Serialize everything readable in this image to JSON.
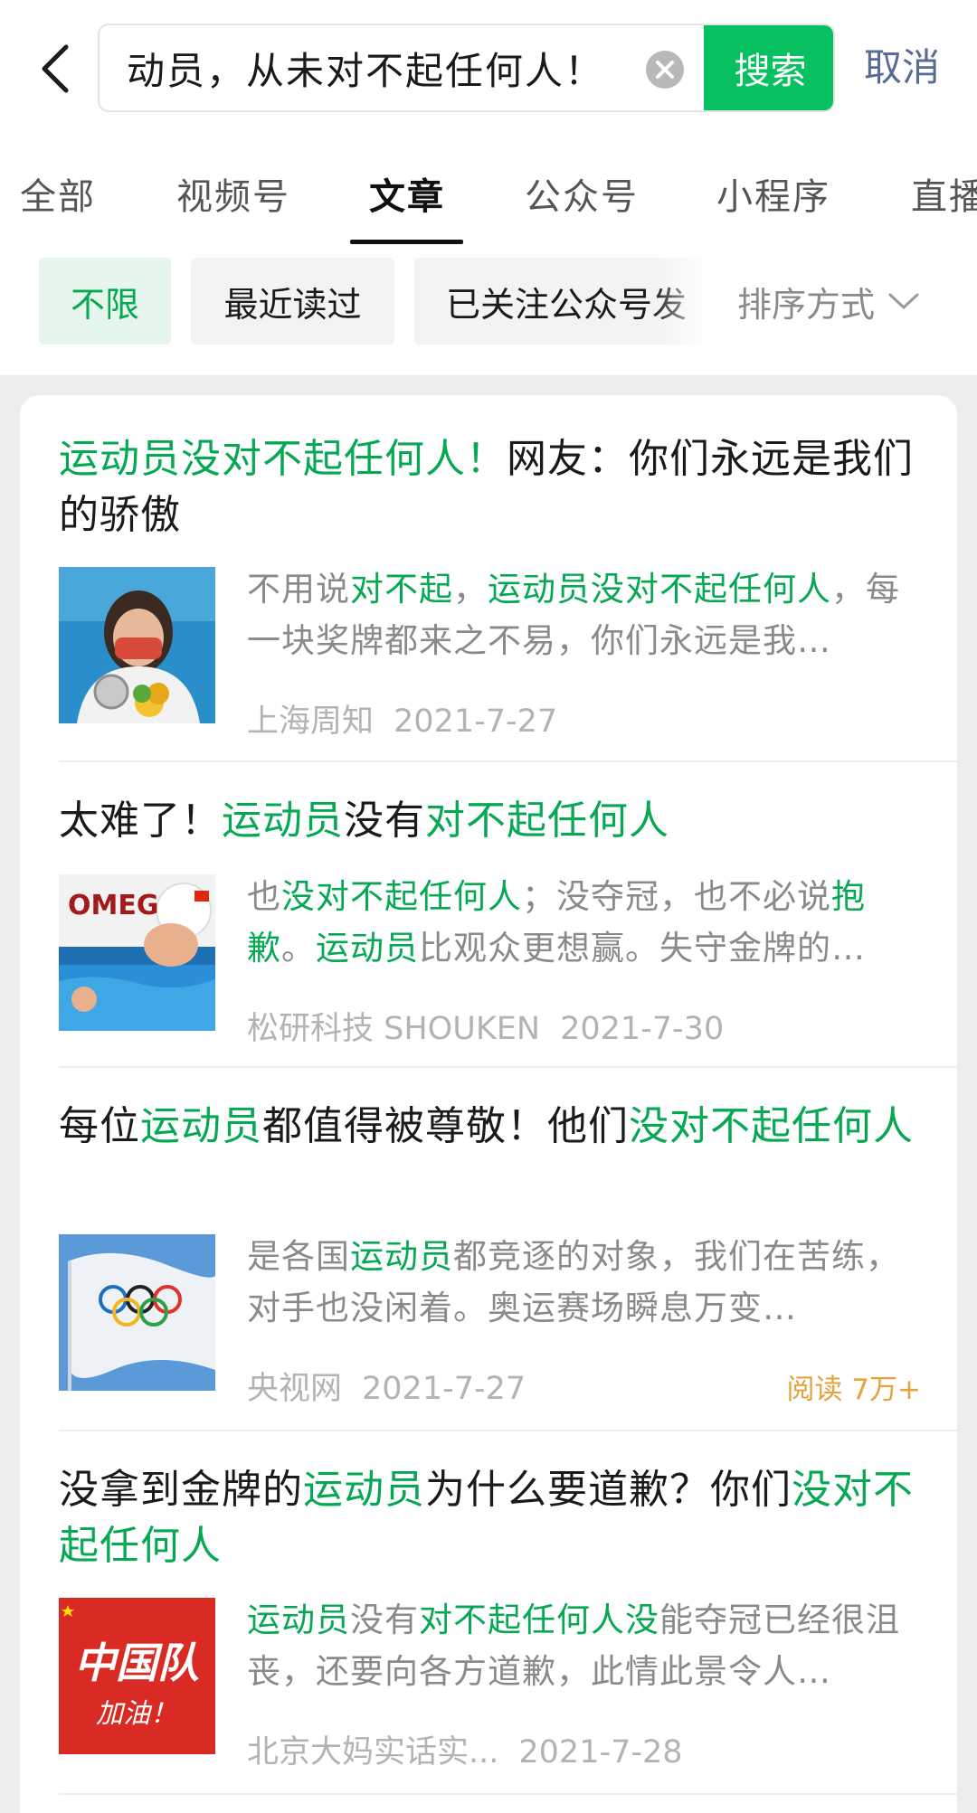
{
  "search": {
    "query": "动员，从未对不起任何人！",
    "button_label": "搜索",
    "cancel_label": "取消"
  },
  "tabs": [
    {
      "label": "全部"
    },
    {
      "label": "视频号"
    },
    {
      "label": "文章"
    },
    {
      "label": "公众号"
    },
    {
      "label": "小程序"
    },
    {
      "label": "直播"
    }
  ],
  "active_tab": "文章",
  "filters": {
    "chips": [
      {
        "label": "不限"
      },
      {
        "label": "最近读过"
      },
      {
        "label": "已关注公众号发"
      }
    ],
    "sort_label": "排序方式"
  },
  "colors": {
    "accent": "#07c160",
    "highlight": "#07a854",
    "link": "#576b95",
    "reads": "#e6a23c"
  },
  "results": [
    {
      "title": [
        {
          "t": "运动员没对不起任何人！",
          "hl": true
        },
        {
          "t": "网友：你们永远是我们的骄傲",
          "hl": false
        }
      ],
      "snippet": [
        {
          "t": "不用说",
          "hl": false
        },
        {
          "t": "对不起",
          "hl": true
        },
        {
          "t": "，",
          "hl": false
        },
        {
          "t": "运动员没对不起任何人",
          "hl": true
        },
        {
          "t": "，每一块奖牌都来之不易，你们永远是我…",
          "hl": false
        }
      ],
      "source": "上海周知",
      "date": "2021-7-27",
      "thumb_icon": "swimmer-silver-medal-photo"
    },
    {
      "title": [
        {
          "t": "太难了！",
          "hl": false
        },
        {
          "t": "运动员",
          "hl": true
        },
        {
          "t": "没有",
          "hl": false
        },
        {
          "t": "对不起任何人",
          "hl": true
        }
      ],
      "snippet": [
        {
          "t": "也",
          "hl": false
        },
        {
          "t": "没对不起任何人",
          "hl": true
        },
        {
          "t": "；没夺冠，也不必说",
          "hl": false
        },
        {
          "t": "抱歉",
          "hl": true
        },
        {
          "t": "。",
          "hl": false
        },
        {
          "t": "运动员",
          "hl": true
        },
        {
          "t": "比观众更想赢。失守金牌的…",
          "hl": false
        }
      ],
      "source": "松研科技 SHOUKEN",
      "date": "2021-7-30",
      "thumb_icon": "swimmer-pool-omega-photo",
      "thumb_text": "OMEG"
    },
    {
      "title": [
        {
          "t": "每位",
          "hl": false
        },
        {
          "t": "运动员",
          "hl": true
        },
        {
          "t": "都值得被尊敬！他们",
          "hl": false
        },
        {
          "t": "没对不起任何人",
          "hl": true
        }
      ],
      "snippet": [
        {
          "t": "是各国",
          "hl": false
        },
        {
          "t": "运动员",
          "hl": true
        },
        {
          "t": "都竞逐的对象，我们在苦练，对手也没闲着。奥运赛场瞬息万变…",
          "hl": false
        }
      ],
      "source": "央视网",
      "date": "2021-7-27",
      "reads": "阅读 7万+",
      "thumb_icon": "olympic-flag-photo"
    },
    {
      "title": [
        {
          "t": "没拿到金牌的",
          "hl": false
        },
        {
          "t": "运动员",
          "hl": true
        },
        {
          "t": "为什么要道歉？你们",
          "hl": false
        },
        {
          "t": "没对不起任何人",
          "hl": true
        }
      ],
      "snippet": [
        {
          "t": "运动员",
          "hl": true
        },
        {
          "t": "没有",
          "hl": false
        },
        {
          "t": "对不起任何人没",
          "hl": true
        },
        {
          "t": "能夺冠已经很沮丧，还要向各方道歉，此情此景令人…",
          "hl": false
        }
      ],
      "source": "北京大妈实话实...",
      "date": "2021-7-28",
      "thumb_icon": "china-team-cheer-image",
      "thumb_text": "中国队",
      "thumb_subtext": "加油！"
    }
  ]
}
